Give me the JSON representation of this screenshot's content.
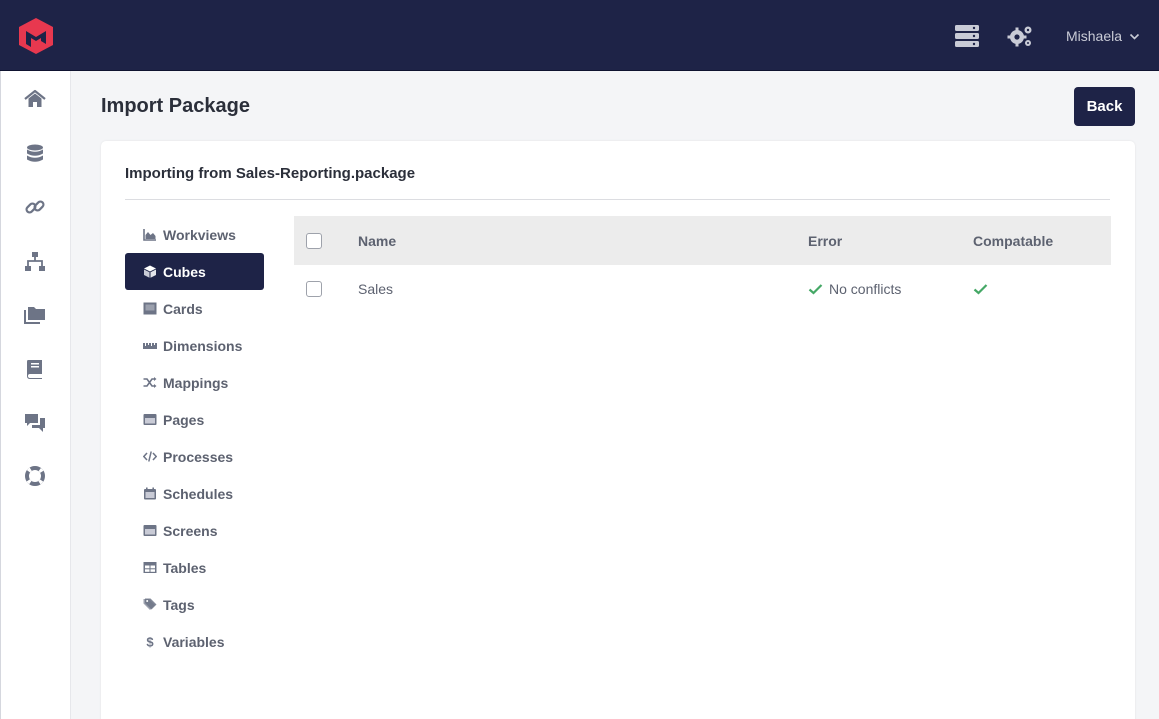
{
  "header": {
    "user_name": "Mishaela",
    "icons": [
      "logo",
      "server-icon",
      "gears-icon",
      "chevron-down-icon"
    ]
  },
  "sidebar": {
    "icons": [
      "home-icon",
      "database-icon",
      "link-icon",
      "sitemap-icon",
      "folders-icon",
      "book-icon",
      "comments-icon",
      "life-ring-icon"
    ]
  },
  "page": {
    "title": "Import Package",
    "back_label": "Back"
  },
  "panel": {
    "title": "Importing from Sales-Reporting.package"
  },
  "type_nav": [
    {
      "label": "Workviews",
      "icon": "chart-area-icon",
      "active": false
    },
    {
      "label": "Cubes",
      "icon": "cube-icon",
      "active": true
    },
    {
      "label": "Cards",
      "icon": "card-icon",
      "active": false
    },
    {
      "label": "Dimensions",
      "icon": "ruler-icon",
      "active": false
    },
    {
      "label": "Mappings",
      "icon": "random-icon",
      "active": false
    },
    {
      "label": "Pages",
      "icon": "window-icon",
      "active": false
    },
    {
      "label": "Processes",
      "icon": "code-icon",
      "active": false
    },
    {
      "label": "Schedules",
      "icon": "calendar-icon",
      "active": false
    },
    {
      "label": "Screens",
      "icon": "window-icon",
      "active": false
    },
    {
      "label": "Tables",
      "icon": "table-icon",
      "active": false
    },
    {
      "label": "Tags",
      "icon": "tags-icon",
      "active": false
    },
    {
      "label": "Variables",
      "icon": "dollar-icon",
      "active": false
    }
  ],
  "grid": {
    "columns": {
      "name": "Name",
      "error": "Error",
      "compatible": "Compatable"
    },
    "rows": [
      {
        "name": "Sales",
        "error": "No conflicts",
        "compatible": true
      }
    ]
  },
  "colors": {
    "navy": "#1e2347",
    "check_green": "#45a866",
    "logo_red": "#e8384f"
  }
}
